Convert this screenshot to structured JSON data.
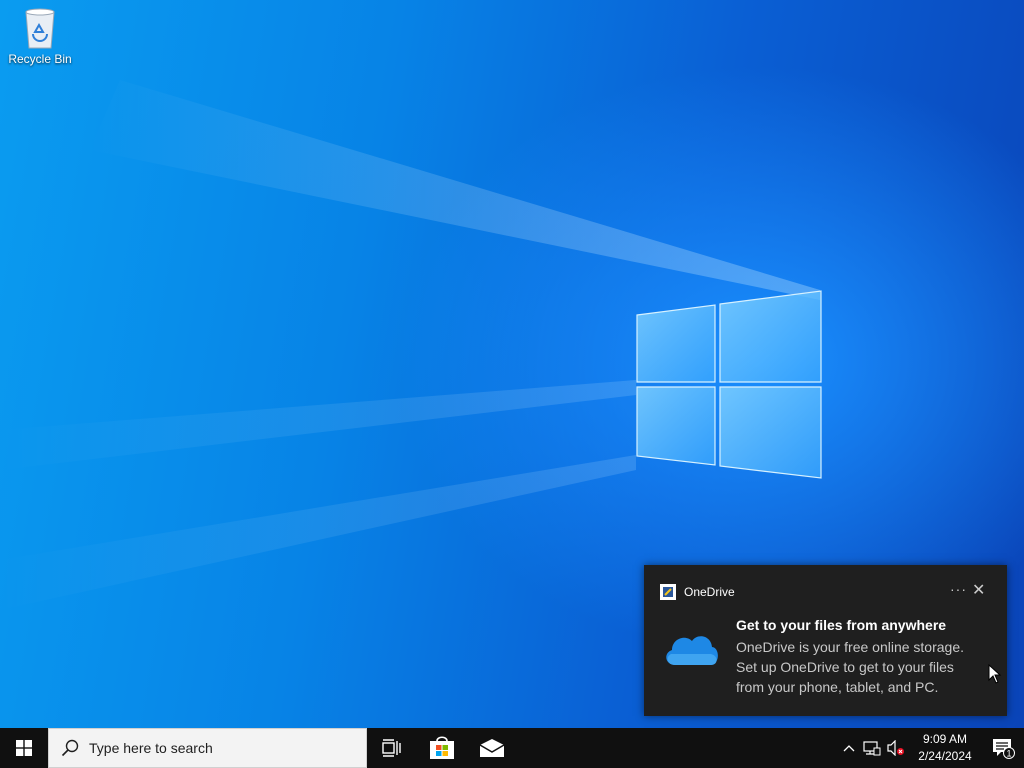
{
  "desktop": {
    "icons": [
      {
        "label": "Recycle Bin",
        "icon": "recycle-bin-icon"
      }
    ]
  },
  "toast": {
    "app_name": "OneDrive",
    "more_icon": "more-options-icon",
    "close_icon": "close-icon",
    "title": "Get to your files from anywhere",
    "body_lines": [
      "OneDrive is your free online storage.",
      "Set up OneDrive to get to your files",
      "from your phone, tablet, and PC."
    ],
    "accent": "#1e88e5"
  },
  "taskbar": {
    "search_placeholder": "Type here to search",
    "clock": {
      "time": "9:09 AM",
      "date": "2/24/2024"
    },
    "notification_count": "1",
    "pinned": [
      "task-view-icon",
      "microsoft-store-icon",
      "mail-icon"
    ],
    "tray": [
      "chevron-up-icon",
      "network-icon",
      "volume-muted-icon",
      "action-center-icon"
    ]
  }
}
